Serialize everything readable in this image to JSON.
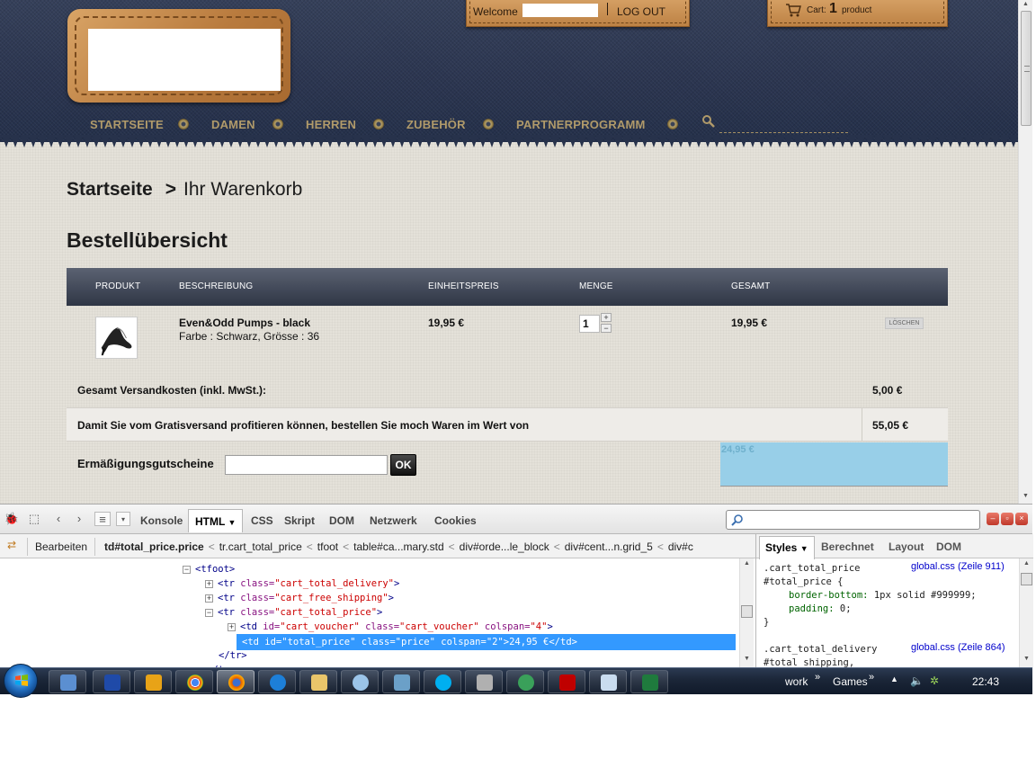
{
  "header": {
    "welcome_label": "Welcome",
    "logout_label": "LOG OUT",
    "cart_label": "Cart:",
    "cart_count": "1",
    "cart_unit": "product"
  },
  "nav": {
    "items": [
      "STARTSEITE",
      "DAMEN",
      "HERREN",
      "ZUBEHÖR",
      "PARTNERPROGRAMM"
    ]
  },
  "breadcrumb": {
    "home": "Startseite",
    "separator": ">",
    "current": "Ihr Warenkorb"
  },
  "page_title": "Bestellübersicht",
  "cart_table": {
    "headers": [
      "PRODUKT",
      "BESCHREIBUNG",
      "EINHEITSPREIS",
      "MENGE",
      "GESAMT"
    ],
    "item": {
      "name": "Even&Odd Pumps - black",
      "variant": "Farbe : Schwarz, Grösse : 36",
      "unit_price": "19,95 €",
      "quantity": "1",
      "qty_plus": "+",
      "qty_minus": "−",
      "line_total": "19,95 €",
      "delete_label": "LÖSCHEN"
    },
    "delivery_label": "Gesamt Versandkosten (inkl. MwSt.):",
    "delivery_value": "5,00 €",
    "free_shipping_label": "Damit Sie vom Gratisversand profitieren können, bestellen Sie moch Waren im Wert von",
    "free_shipping_value": "55,05 €",
    "voucher_label": "Ermäßigungsgutscheine",
    "voucher_ok": "OK",
    "total_price": "24,95 €"
  },
  "firebug": {
    "tabs": [
      "Konsole",
      "HTML",
      "CSS",
      "Skript",
      "DOM",
      "Netzwerk",
      "Cookies"
    ],
    "active_tab": "HTML",
    "edit_label": "Bearbeiten",
    "crumbs": [
      "td#total_price.price",
      "tr.cart_total_price",
      "tfoot",
      "table#ca...mary.std",
      "div#orde...le_block",
      "div#cent...n.grid_5",
      "div#c"
    ],
    "source_lines": [
      {
        "tw": "−",
        "indent": 205,
        "html": "<tfoot>"
      },
      {
        "tw": "+",
        "indent": 230,
        "tag": "tr",
        "attrs": [
          [
            "class",
            "cart_total_delivery"
          ]
        ]
      },
      {
        "tw": "+",
        "indent": 230,
        "tag": "tr",
        "attrs": [
          [
            "class",
            "cart_free_shipping"
          ]
        ]
      },
      {
        "tw": "−",
        "indent": 230,
        "tag": "tr",
        "attrs": [
          [
            "class",
            "cart_total_price"
          ]
        ]
      },
      {
        "tw": "+",
        "indent": 255,
        "tag": "td",
        "attrs": [
          [
            "id",
            "cart_voucher"
          ],
          [
            "class",
            "cart_voucher"
          ],
          [
            "colspan",
            "4"
          ]
        ]
      },
      {
        "tw": "",
        "indent": 243,
        "html": "</tr>"
      },
      {
        "tw": "",
        "indent": 230,
        "html": "</t..."
      }
    ],
    "selected_line": "<td id=\"total_price\" class=\"price\" colspan=\"2\">24,95 €</td>",
    "side_tabs": [
      "Styles",
      "Berechnet",
      "Layout",
      "DOM"
    ],
    "active_side_tab": "Styles",
    "styles": [
      {
        "text": ".cart_total_price",
        "source": "global.css (Zeile 911)"
      },
      {
        "text": "#total_price {"
      },
      {
        "prop": "border-bottom",
        "value": "1px solid #999999;"
      },
      {
        "prop": "padding",
        "value": "0;"
      },
      {
        "text": "}"
      },
      {
        "text": ""
      },
      {
        "text": ".cart_total_delivery",
        "source": "global.css (Zeile 864)"
      },
      {
        "text": "#total_shipping,"
      },
      {
        "text": ".cart_total_price"
      }
    ]
  },
  "taskbar": {
    "tray_labels": [
      "work",
      "Games"
    ],
    "clock": "22:43"
  },
  "colors": {
    "header_denim": "#2b3550",
    "leather": "#c98f50",
    "table_header": "#3e4555",
    "highlight": "#98cfe8",
    "selection": "#3399ff"
  }
}
